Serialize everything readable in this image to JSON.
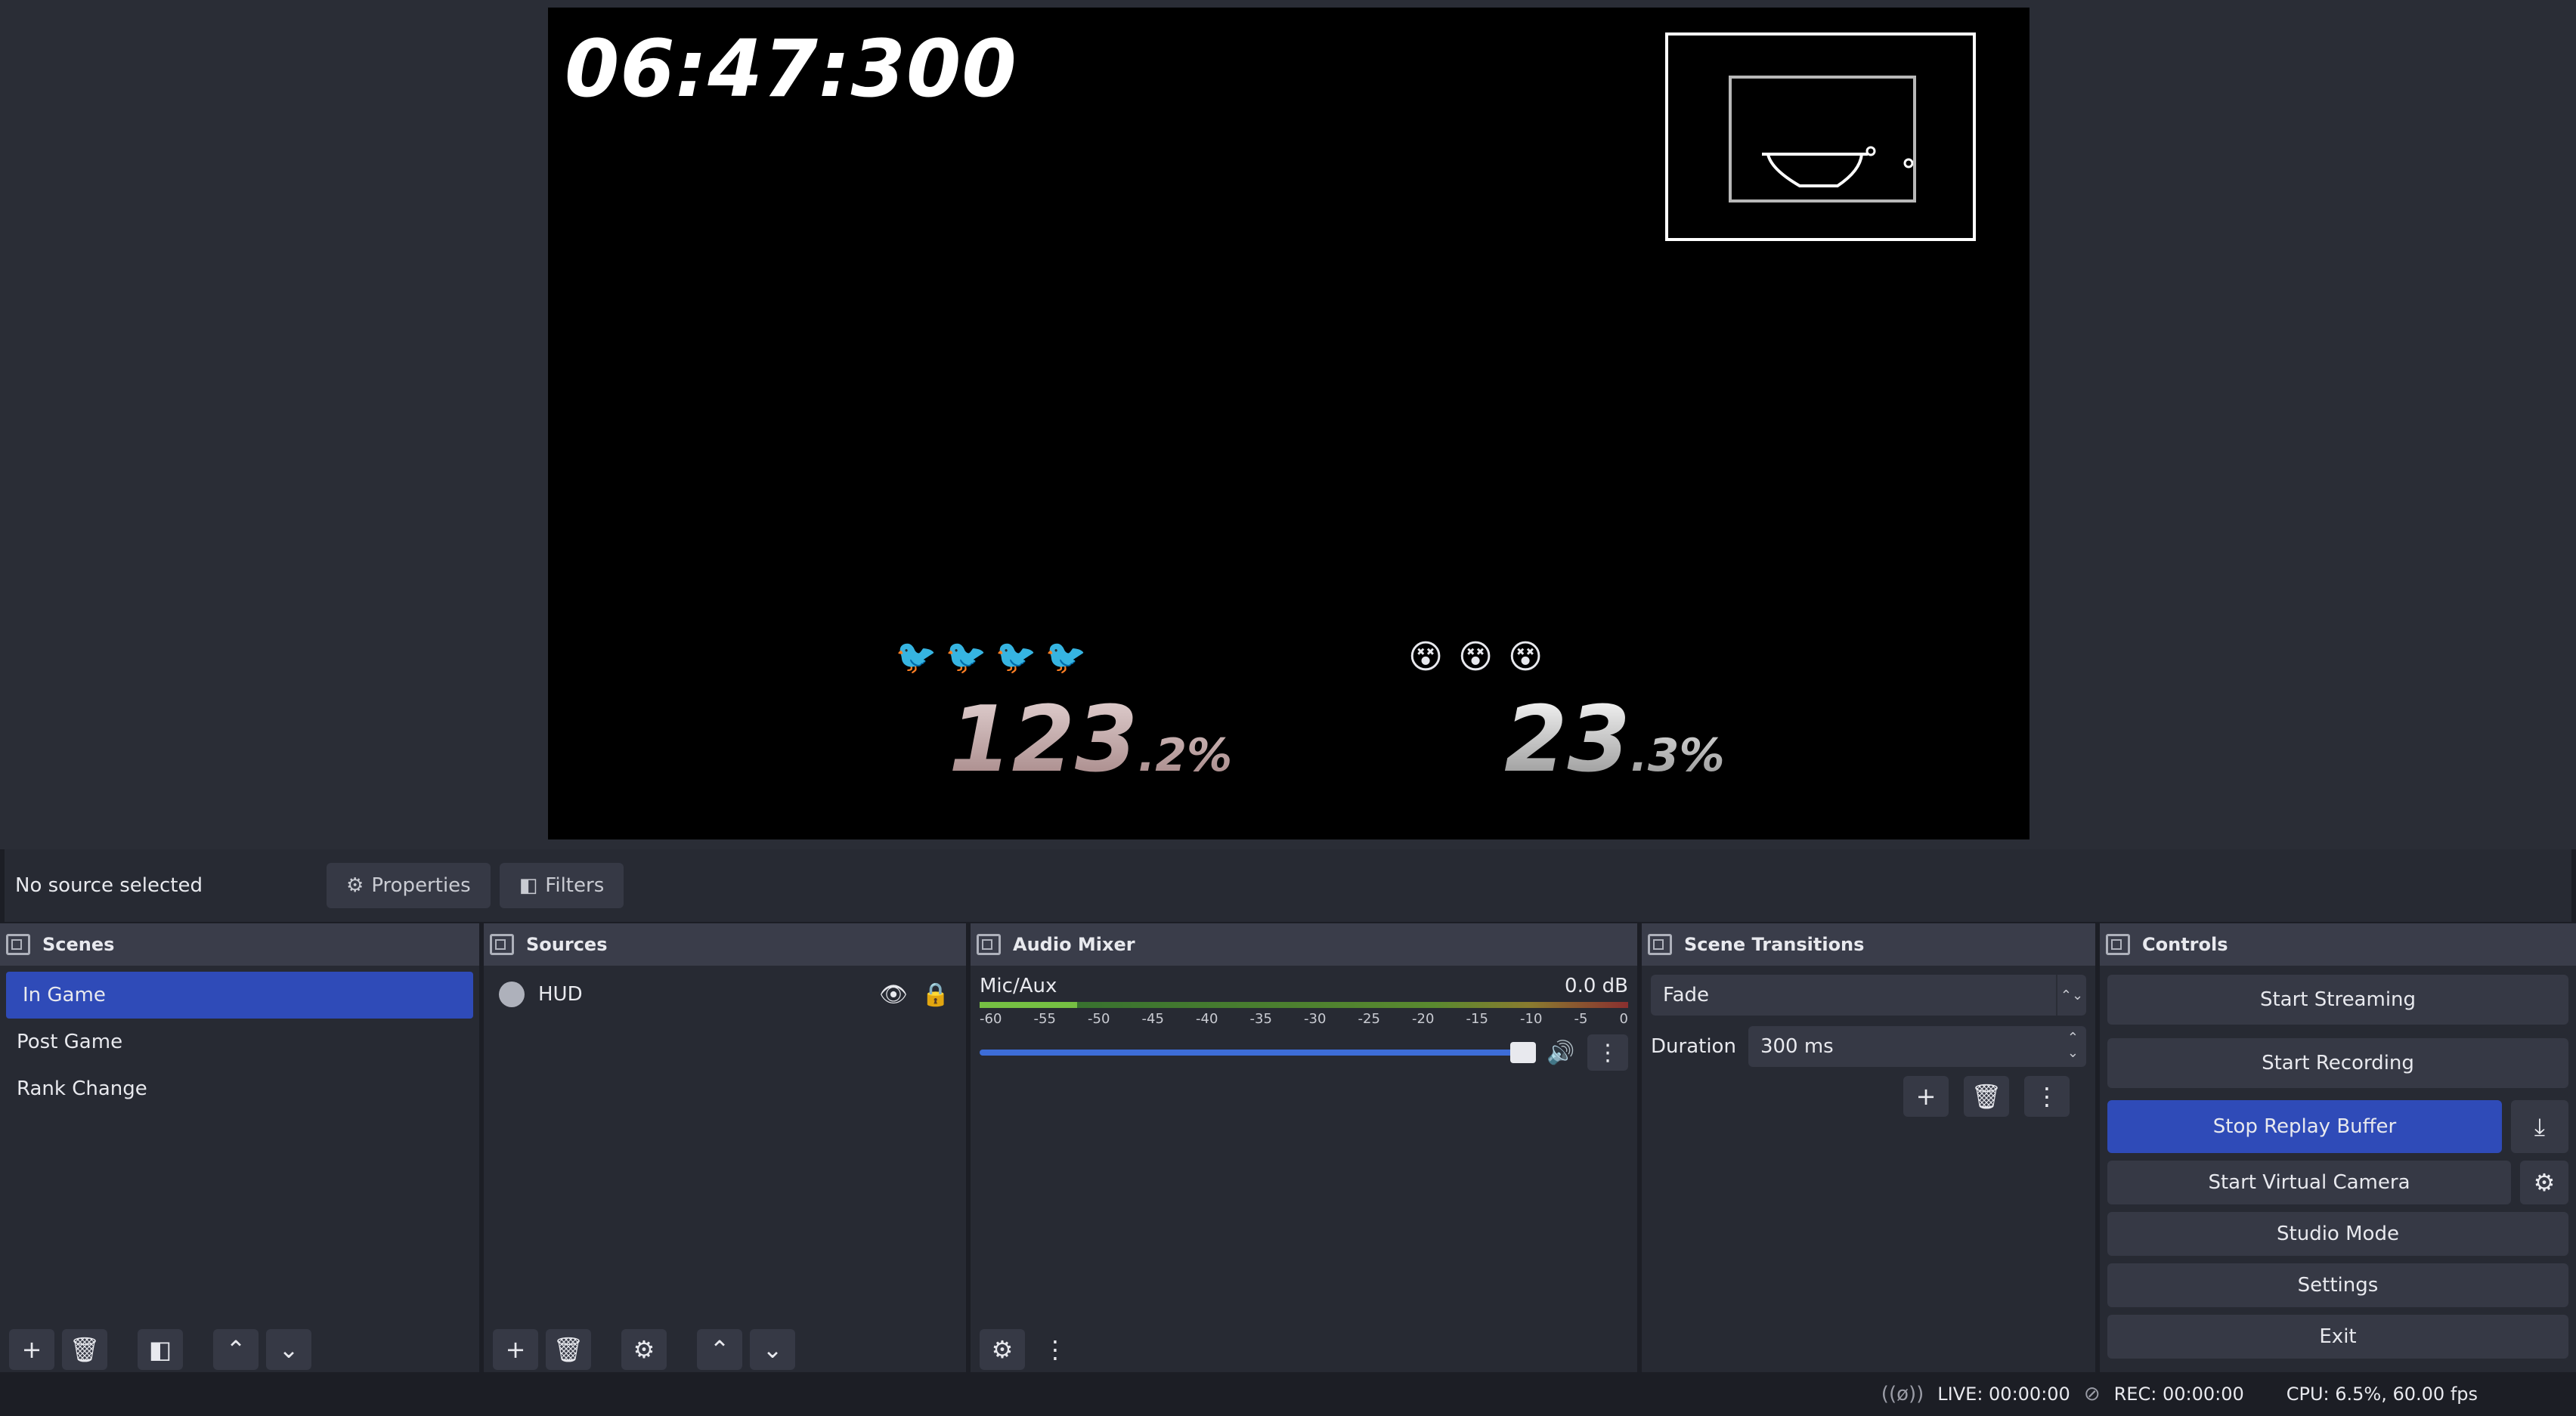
{
  "preview": {
    "timer": "06:47:300",
    "player1": {
      "percent_big": "123",
      "percent_small": ".2%",
      "stocks": 4
    },
    "player2": {
      "percent_big": "23",
      "percent_small": ".3%",
      "stocks": 3
    }
  },
  "source_bar": {
    "status": "No source selected",
    "properties_label": "Properties",
    "filters_label": "Filters"
  },
  "scenes": {
    "title": "Scenes",
    "items": [
      {
        "label": "In Game",
        "selected": true
      },
      {
        "label": "Post Game",
        "selected": false
      },
      {
        "label": "Rank Change",
        "selected": false
      }
    ]
  },
  "sources": {
    "title": "Sources",
    "items": [
      {
        "label": "HUD",
        "type": "browser",
        "visible": true,
        "locked": false
      }
    ]
  },
  "audio_mixer": {
    "title": "Audio Mixer",
    "channel": {
      "name": "Mic/Aux",
      "level": "0.0 dB",
      "volume_fraction": 1.0
    },
    "ticks": [
      "-60",
      "-55",
      "-50",
      "-45",
      "-40",
      "-35",
      "-30",
      "-25",
      "-20",
      "-15",
      "-10",
      "-5",
      "0"
    ]
  },
  "scene_transitions": {
    "title": "Scene Transitions",
    "transition": "Fade",
    "duration_label": "Duration",
    "duration_value": "300 ms"
  },
  "controls": {
    "title": "Controls",
    "start_streaming": "Start Streaming",
    "start_recording": "Start Recording",
    "stop_replay_buffer": "Stop Replay Buffer",
    "start_virtual_camera": "Start Virtual Camera",
    "studio_mode": "Studio Mode",
    "settings": "Settings",
    "exit": "Exit"
  },
  "status_bar": {
    "live": "LIVE: 00:00:00",
    "rec": "REC: 00:00:00",
    "cpu": "CPU: 6.5%, 60.00 fps"
  },
  "colors": {
    "accent": "#2f4bb8",
    "background": "#1c1e25",
    "panel": "#272a33",
    "dock_title": "#3a3d4a",
    "button": "#363945"
  },
  "icons": [
    "plus-icon",
    "trash-icon",
    "filter-icon",
    "chevron-up-icon",
    "chevron-down-icon",
    "gear-icon",
    "eye-icon",
    "lock-icon",
    "speaker-icon",
    "kebab-icon",
    "download-icon",
    "globe-icon",
    "no-signal-icon"
  ]
}
